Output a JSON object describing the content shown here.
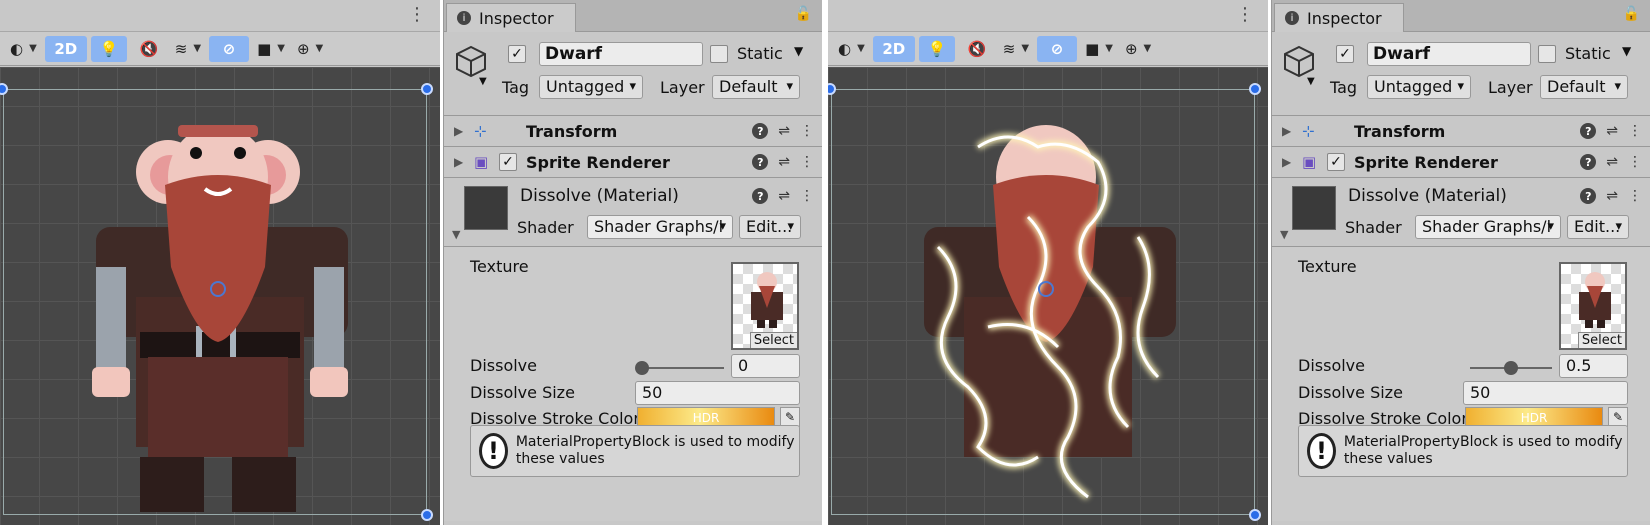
{
  "panels": [
    {
      "scene": {
        "toolbar": {
          "mode_2d": "2D"
        }
      },
      "inspector": {
        "tab_label": "Inspector",
        "gameobject": {
          "name": "Dwarf",
          "static_label": "Static",
          "tag_label": "Tag",
          "tag_value": "Untagged",
          "layer_label": "Layer",
          "layer_value": "Default"
        },
        "components": [
          {
            "name": "Transform"
          },
          {
            "name": "Sprite Renderer"
          }
        ],
        "material": {
          "title": "Dissolve (Material)",
          "shader_label": "Shader",
          "shader_value": "Shader Graphs/l",
          "edit_label": "Edit..."
        },
        "properties": {
          "texture_label": "Texture",
          "texture_select": "Select",
          "dissolve_label": "Dissolve",
          "dissolve_value": "0",
          "dissolve_fraction": 0.0,
          "dissolve_size_label": "Dissolve Size",
          "dissolve_size_value": "50",
          "stroke_color_label": "Dissolve Stroke Color",
          "hdr_label": "HDR"
        },
        "help_text": "MaterialPropertyBlock is used to modify these values"
      }
    },
    {
      "scene": {
        "toolbar": {
          "mode_2d": "2D"
        }
      },
      "inspector": {
        "tab_label": "Inspector",
        "gameobject": {
          "name": "Dwarf",
          "static_label": "Static",
          "tag_label": "Tag",
          "tag_value": "Untagged",
          "layer_label": "Layer",
          "layer_value": "Default"
        },
        "components": [
          {
            "name": "Transform"
          },
          {
            "name": "Sprite Renderer"
          }
        ],
        "material": {
          "title": "Dissolve (Material)",
          "shader_label": "Shader",
          "shader_value": "Shader Graphs/l",
          "edit_label": "Edit..."
        },
        "properties": {
          "texture_label": "Texture",
          "texture_select": "Select",
          "dissolve_label": "Dissolve",
          "dissolve_value": "0.5",
          "dissolve_fraction": 0.5,
          "dissolve_size_label": "Dissolve Size",
          "dissolve_size_value": "50",
          "stroke_color_label": "Dissolve Stroke Color",
          "hdr_label": "HDR"
        },
        "help_text": "MaterialPropertyBlock is used to modify these values"
      }
    }
  ],
  "colors": {
    "accent": "#8ab4f2",
    "handle": "#2a6ce8",
    "scene_bg": "#474747",
    "panel_bg": "#c8c8c8"
  }
}
